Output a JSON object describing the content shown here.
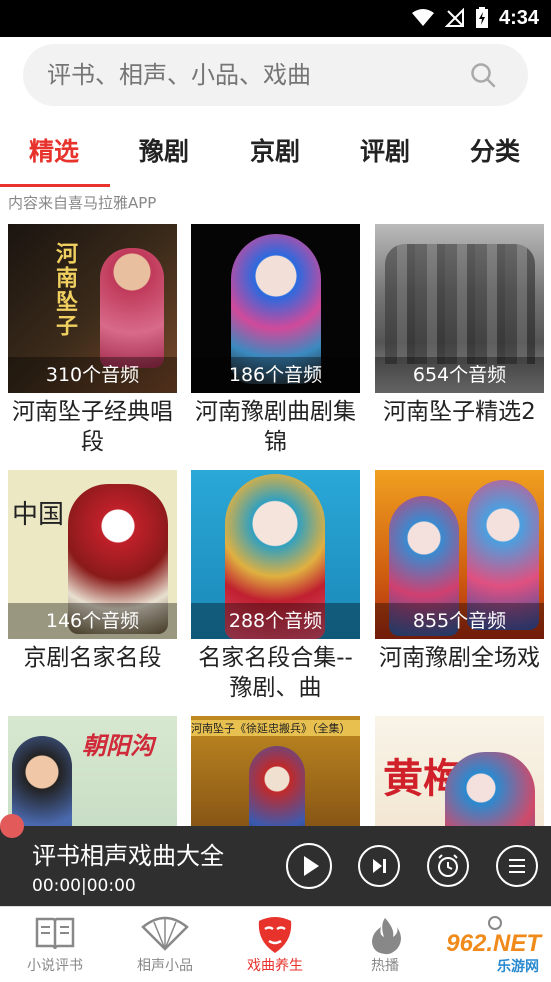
{
  "status": {
    "time": "4:34"
  },
  "search": {
    "placeholder": "评书、相声、小品、戏曲"
  },
  "tabs": [
    {
      "label": "精选"
    },
    {
      "label": "豫剧"
    },
    {
      "label": "京剧"
    },
    {
      "label": "评剧"
    },
    {
      "label": "分类"
    }
  ],
  "source_note": "内容来自喜马拉雅APP",
  "cards": [
    {
      "count": "310个音频",
      "title": "河南坠子经典唱段",
      "overlay": "河南坠子"
    },
    {
      "count": "186个音频",
      "title": "河南豫剧曲剧集锦",
      "overlay": ""
    },
    {
      "count": "654个音频",
      "title": "河南坠子精选2",
      "overlay": ""
    },
    {
      "count": "146个音频",
      "title": "京剧名家名段",
      "overlay": "中国"
    },
    {
      "count": "288个音频",
      "title": "名家名段合集--豫剧、曲",
      "overlay": ""
    },
    {
      "count": "855个音频",
      "title": "河南豫剧全场戏",
      "overlay": ""
    },
    {
      "count": "",
      "title": "",
      "overlay": "朝阳沟"
    },
    {
      "count": "",
      "title": "",
      "overlay": "河南坠子《徐延忠搬兵》（全集）"
    },
    {
      "count": "",
      "title": "",
      "overlay": "黄梅"
    }
  ],
  "player": {
    "title": "评书相声戏曲大全",
    "time": "00:00|00:00"
  },
  "nav": [
    {
      "label": "小说评书"
    },
    {
      "label": "相声小品"
    },
    {
      "label": "戏曲养生"
    },
    {
      "label": "热播"
    }
  ],
  "watermark": {
    "text": "962.NET",
    "sub": "乐游网"
  },
  "colors": {
    "accent": "#e8322c",
    "player_bg": "#2f2f2f"
  }
}
